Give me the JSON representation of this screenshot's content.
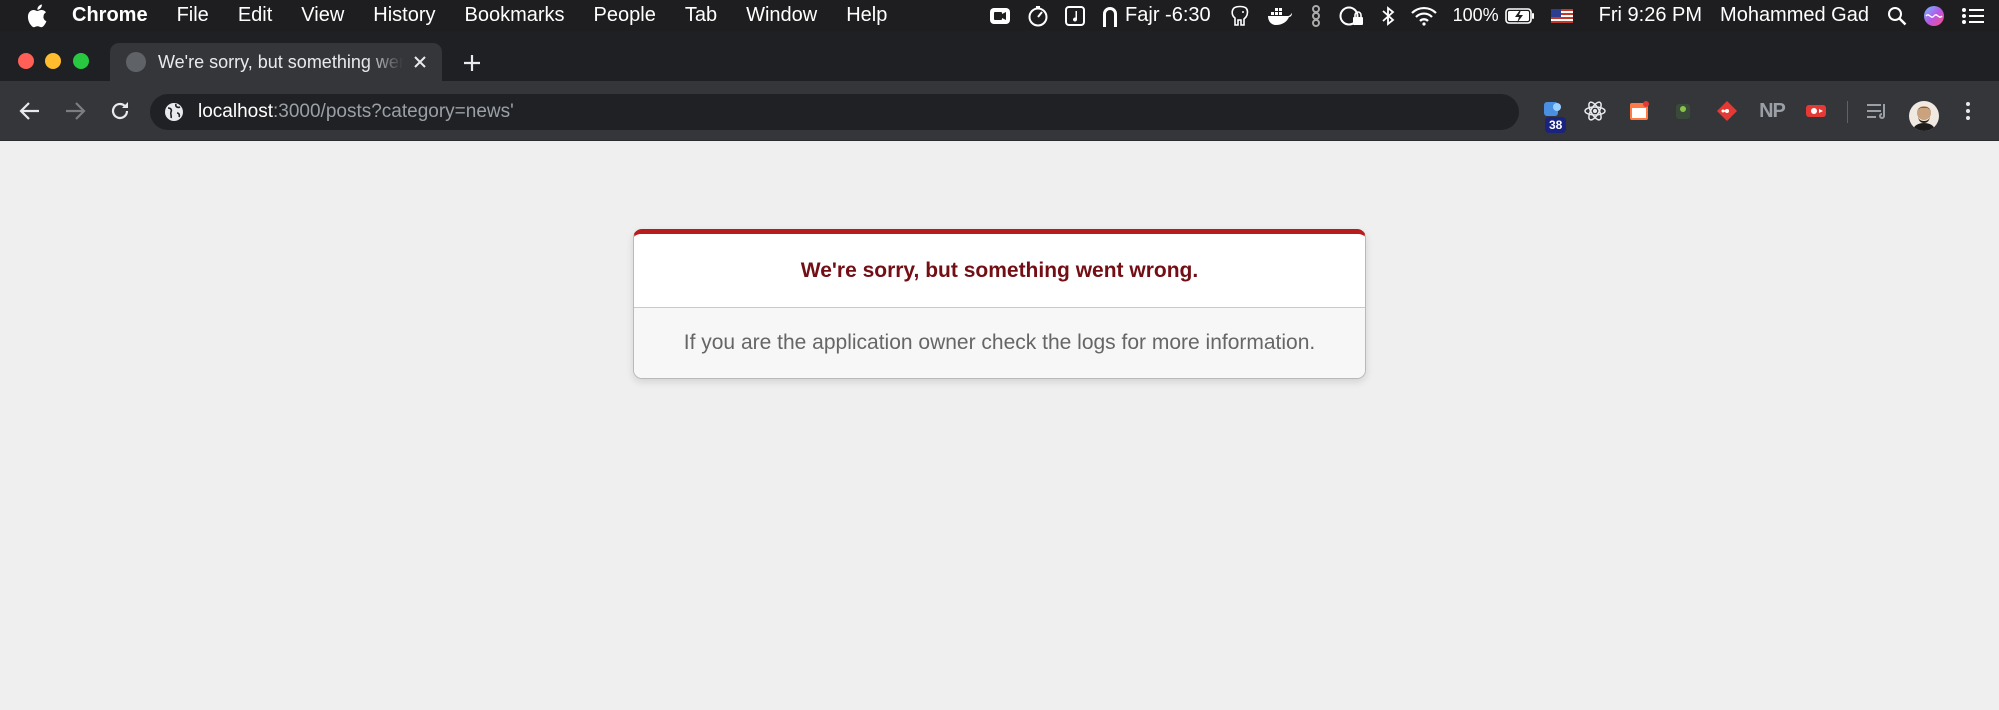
{
  "menubar": {
    "app_name": "Chrome",
    "items": [
      "File",
      "Edit",
      "View",
      "History",
      "Bookmarks",
      "People",
      "Tab",
      "Window",
      "Help"
    ],
    "prayer": "Fajr -6:30",
    "battery": "100%",
    "clock": "Fri 9:26 PM",
    "user": "Mohammed Gad"
  },
  "tab": {
    "title": "We're sorry, but something went wrong"
  },
  "omnibox": {
    "host": "localhost",
    "path": ":3000/posts?category=news'"
  },
  "extensions": {
    "badge_count": "38",
    "np_label": "NP"
  },
  "error": {
    "heading": "We're sorry, but something went wrong.",
    "message": "If you are the application owner check the logs for more information."
  },
  "colors": {
    "accent_red": "#b81c1c",
    "heading_red": "#730e15",
    "page_bg": "#efefef"
  }
}
